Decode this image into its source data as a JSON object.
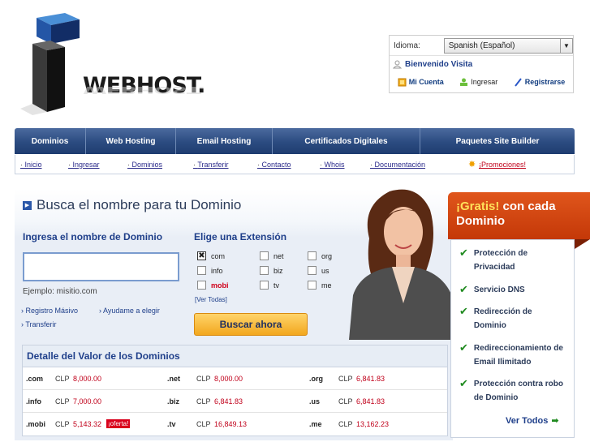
{
  "logo": {
    "text": "WEBHOST."
  },
  "toppanel": {
    "language_label": "Idioma:",
    "language_value": "Spanish (Español)",
    "welcome": "Bienvenido Visita",
    "account": "Mi Cuenta",
    "login": "Ingresar",
    "register": "Registrarse"
  },
  "mainnav": [
    "Dominios",
    "Web Hosting",
    "Email Hosting",
    "Certificados Digitales",
    "Paquetes Site Builder"
  ],
  "subnav": {
    "items": [
      "Inicio",
      "Ingresar",
      "Dominios",
      "Transferir",
      "Contacto",
      "Whois",
      "Documentación"
    ],
    "promo": "¡Promociones!"
  },
  "search": {
    "heading": "Busca el nombre para tu Dominio",
    "input_label": "Ingresa el nombre de Dominio",
    "input_value": "",
    "example": "Ejemplo: misitio.com",
    "links": [
      "Registro Másivo",
      "Ayudame a elegir",
      "Transferir"
    ],
    "ext_label": "Elige una Extensión",
    "extensions": [
      {
        "name": "com",
        "checked": true,
        "highlight": false
      },
      {
        "name": "net",
        "checked": false,
        "highlight": false
      },
      {
        "name": "org",
        "checked": false,
        "highlight": false
      },
      {
        "name": "info",
        "checked": false,
        "highlight": false
      },
      {
        "name": "biz",
        "checked": false,
        "highlight": false
      },
      {
        "name": "us",
        "checked": false,
        "highlight": false
      },
      {
        "name": "mobi",
        "checked": false,
        "highlight": true
      },
      {
        "name": "tv",
        "checked": false,
        "highlight": false
      },
      {
        "name": "me",
        "checked": false,
        "highlight": false
      }
    ],
    "see_all": "[Ver Todas]",
    "button": "Buscar ahora"
  },
  "prices": {
    "title": "Detalle del Valor de los Dominios",
    "currency": "CLP",
    "offer_badge": "¡oferta!",
    "rows": [
      [
        {
          "tld": ".com",
          "price": "8,000.00"
        },
        {
          "tld": ".net",
          "price": "8,000.00"
        },
        {
          "tld": ".org",
          "price": "6,841.83"
        }
      ],
      [
        {
          "tld": ".info",
          "price": "7,000.00"
        },
        {
          "tld": ".biz",
          "price": "6,841.83"
        },
        {
          "tld": ".us",
          "price": "6,841.83"
        }
      ],
      [
        {
          "tld": ".mobi",
          "price": "5,143.32"
        },
        {
          "tld": ".tv",
          "price": "16,849.13"
        },
        {
          "tld": ".me",
          "price": "13,162.23"
        }
      ]
    ]
  },
  "promo": {
    "gratis": "¡Gratis!",
    "head_rest": " con cada",
    "head_line2": "Dominio",
    "items": [
      "Protección de Privacidad",
      "Servicio DNS",
      "Redirección de Dominio",
      "Redireccionamiento de Email Ilimitado",
      "Protección contra robo de Dominio"
    ],
    "see_all": "Ver Todos"
  },
  "colors": {
    "nav": "#2b4b80",
    "accent_orange": "#c43808",
    "price_red": "#c0001a",
    "link_blue": "#1f3f8a"
  }
}
